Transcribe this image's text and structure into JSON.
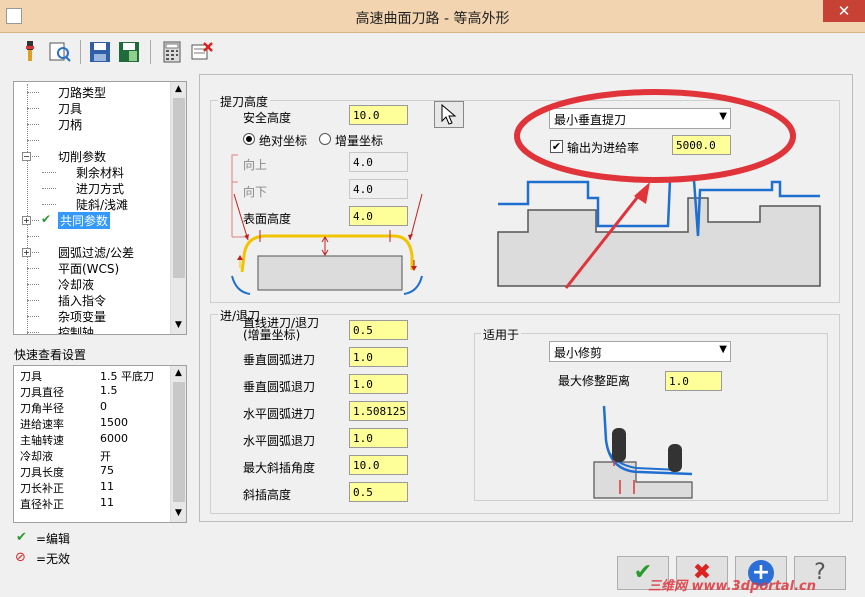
{
  "window": {
    "title": "高速曲面刀路 - 等高外形",
    "close": "✕"
  },
  "tree": {
    "items": [
      {
        "label": "刀路类型",
        "indent": 1
      },
      {
        "label": "刀具",
        "indent": 1
      },
      {
        "label": "刀柄",
        "indent": 1
      },
      {
        "label": "",
        "indent": 1
      },
      {
        "label": "切削参数",
        "indent": 1
      },
      {
        "label": "剩余材料",
        "indent": 2
      },
      {
        "label": "进刀方式",
        "indent": 2
      },
      {
        "label": "陡斜/浅滩",
        "indent": 2
      },
      {
        "label": "共同参数",
        "indent": 1
      },
      {
        "label": "",
        "indent": 1
      },
      {
        "label": "圆弧过滤/公差",
        "indent": 1
      },
      {
        "label": "平面(WCS)",
        "indent": 1
      },
      {
        "label": "冷却液",
        "indent": 1
      },
      {
        "label": "插入指令",
        "indent": 1
      },
      {
        "label": "杂项变量",
        "indent": 1
      },
      {
        "label": "控制轴",
        "indent": 1
      }
    ]
  },
  "quickview": {
    "title": "快速查看设置",
    "rows": [
      {
        "k": "刀具",
        "v": "1.5 平底刀"
      },
      {
        "k": "刀具直径",
        "v": "1.5"
      },
      {
        "k": "刀角半径",
        "v": "0"
      },
      {
        "k": "进给速率",
        "v": "1500"
      },
      {
        "k": "主轴转速",
        "v": "6000"
      },
      {
        "k": "冷却液",
        "v": "开"
      },
      {
        "k": "刀具长度",
        "v": "75"
      },
      {
        "k": "刀长补正",
        "v": "11"
      },
      {
        "k": "直径补正",
        "v": "11"
      }
    ]
  },
  "legend": {
    "edit": "=编辑",
    "invalid": "=无效"
  },
  "retract": {
    "group_title": "提刀高度",
    "safe_height_label": "安全高度",
    "safe_height": "10.0",
    "abs_label": "绝对坐标",
    "inc_label": "增量坐标",
    "up_label": "向上",
    "up_value": "4.0",
    "down_label": "向下",
    "down_value": "4.0",
    "surface_label": "表面高度",
    "surface_value": "4.0",
    "mode_combo": "最小垂直提刀",
    "output_feed_label": "输出为进给率",
    "output_feed_value": "5000.0"
  },
  "entry": {
    "group_title": "进/退刀",
    "rows": [
      {
        "label": "直线进刀/退刀",
        "label2": "(增量坐标)",
        "value": "0.5"
      },
      {
        "label": "垂直圆弧进刀",
        "value": "1.0"
      },
      {
        "label": "垂直圆弧退刀",
        "value": "1.0"
      },
      {
        "label": "水平圆弧进刀",
        "value": "1.508125"
      },
      {
        "label": "水平圆弧退刀",
        "value": "1.0"
      },
      {
        "label": "最大斜插角度",
        "value": "10.0"
      },
      {
        "label": "斜插高度",
        "value": "0.5"
      }
    ],
    "apply_title": "适用于",
    "apply_combo": "最小修剪",
    "min_trim_label": "最大修整距离",
    "min_trim_value": "1.0"
  },
  "buttons": {
    "ok": "✔",
    "cancel": "✖",
    "add": "+",
    "help": "?"
  },
  "watermark": "三维网 www.3dportal.cn",
  "colors": {
    "titlebar": "#f2d4b0",
    "field": "#ffff99",
    "highlight": "#3399ff",
    "annotation": "#e0343a"
  }
}
